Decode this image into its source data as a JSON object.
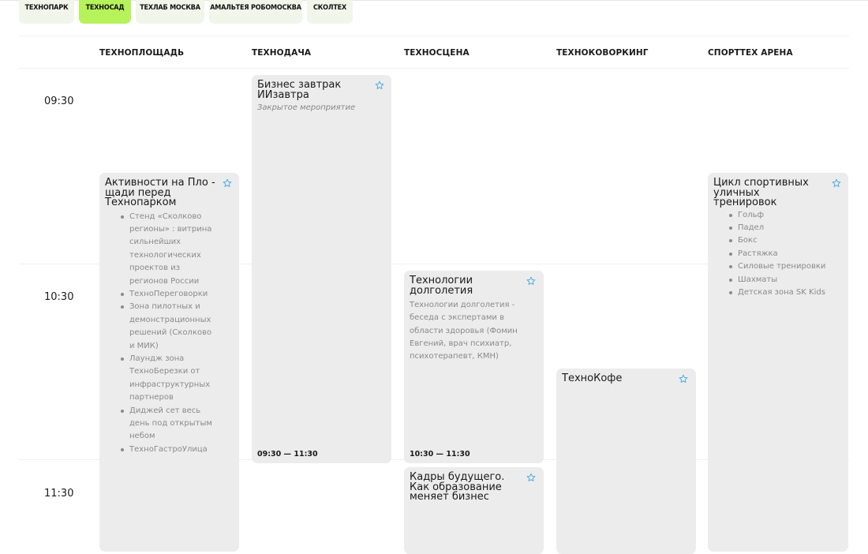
{
  "tabs": [
    {
      "label": "ТЕХНОПАРК",
      "active": false
    },
    {
      "label": "ТЕХНОСАД",
      "active": true
    },
    {
      "label": "ТЕХЛАБ МОСКВА",
      "active": false
    },
    {
      "label": "АМАЛЬТЕЯ РОБОМОСКВА",
      "active": false
    },
    {
      "label": "СКОЛТЕХ",
      "active": false
    }
  ],
  "venues": [
    "ТЕХНОПЛОЩАДЬ",
    "ТЕХНОДАЧА",
    "ТЕХНОСЦЕНА",
    "ТЕХНОКОВОРКИНГ",
    "СПОРТТЕХ АРЕНА"
  ],
  "times": [
    "09:30",
    "10:30",
    "11:30"
  ],
  "events": {
    "ploshad": {
      "title": "Активности на Пло - щади перед Технопарком",
      "items": [
        "Стенд «Сколково регионы» : витрина сильнейших технологических проектов из регионов России",
        "ТехноПереговорки",
        "Зона пилотных и демонстрационных решений (Сколково и МИК)",
        "Лаундж зона ТехноБерезки от инфраструктурных партнеров",
        "Диджей сет весь день под открытым небом",
        "ТехноГастроУлица"
      ]
    },
    "dacha": {
      "title": "Бизнес завтрак ИИзавтра",
      "subtitle": "Закрытое мероприятие",
      "time": "09:30 — 11:30"
    },
    "scena1": {
      "title": "Технологии долголетия",
      "description": "Технологии долголетия - беседа с экспертами в области здоровья (Фомин Евгений, врач психиатр, психотерапевт, КМН)",
      "time": "10:30 — 11:30"
    },
    "scena2": {
      "title": "Кадры будущего. Как образование меняет бизнес"
    },
    "coworking": {
      "title": "ТехноКофе"
    },
    "arena": {
      "title": "Цикл спортивных уличных тренировок",
      "items": [
        "Гольф",
        "Падел",
        "Бокс",
        "Растяжка",
        "Силовые тренировки",
        "Шахматы",
        "Детская зона SK Kids"
      ]
    }
  },
  "colors": {
    "accent": "#b6f25a",
    "tab": "#f2f5ea",
    "card": "#ececec",
    "star": "#4aa8e0"
  }
}
